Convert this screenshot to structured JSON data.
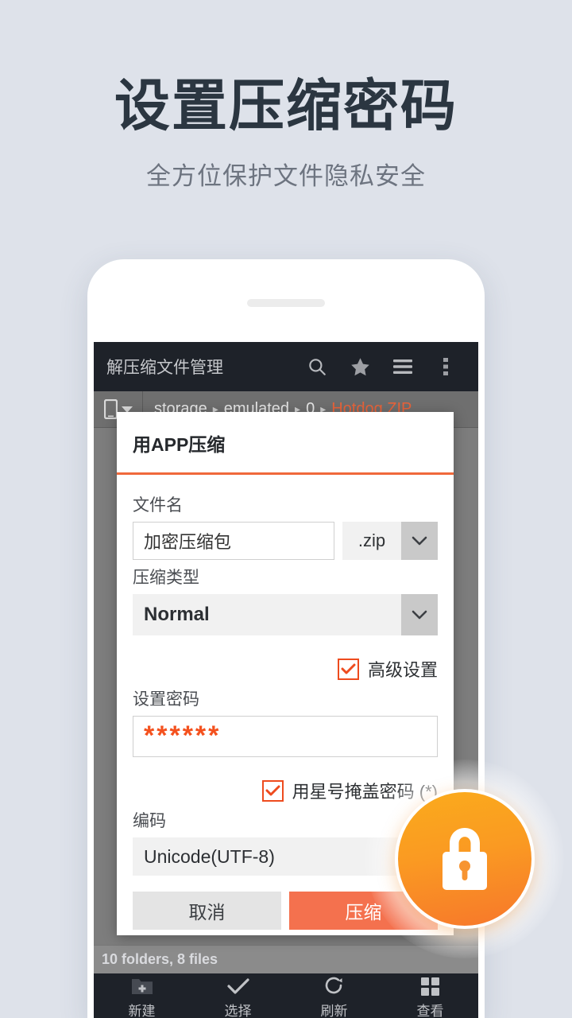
{
  "promo": {
    "title": "设置压缩密码",
    "subtitle": "全方位保护文件隐私安全"
  },
  "colors": {
    "background": "#dee2ea",
    "accent_orange": "#f0693b",
    "button_compress": "#f4714e",
    "checkbox_orange": "#ee4b1e",
    "password_text": "#f4511e",
    "appbar_dark": "#1e2229",
    "breadcrumb_current": "#e8633a"
  },
  "app": {
    "title": "解压缩文件管理",
    "appbar_icons": [
      {
        "name": "search-icon",
        "label": "搜索"
      },
      {
        "name": "star-icon",
        "label": "收藏"
      },
      {
        "name": "hamburger-icon",
        "label": "菜单"
      },
      {
        "name": "overflow-menu-icon",
        "label": "更多"
      }
    ],
    "breadcrumb": {
      "device_icon": "phone-icon",
      "dropdown_icon": "caret-down-icon",
      "separator": "▸",
      "segments": [
        "storage",
        "emulated",
        "0"
      ],
      "current": "Hotdog ZIP"
    },
    "status_text": "10 folders, 8 files",
    "bottom_nav": [
      {
        "icon": "new-folder-icon",
        "label": "新建"
      },
      {
        "icon": "check-icon",
        "label": "选择"
      },
      {
        "icon": "refresh-icon",
        "label": "刷新"
      },
      {
        "icon": "grid-view-icon",
        "label": "查看"
      }
    ]
  },
  "dialog": {
    "title": "用APP压缩",
    "filename": {
      "label": "文件名",
      "value": "加密压缩包",
      "placeholder": "文件名",
      "extension": ".zip"
    },
    "compression_type": {
      "label": "压缩类型",
      "value": "Normal"
    },
    "advanced": {
      "label": "高级设置",
      "checked": true
    },
    "password": {
      "label": "设置密码",
      "value": "******",
      "placeholder": "设置密码"
    },
    "mask_password": {
      "label": "用星号掩盖密码 (*)",
      "checked": true
    },
    "encoding": {
      "label": "编码",
      "value": "Unicode(UTF-8)"
    },
    "buttons": {
      "cancel": "取消",
      "confirm": "压缩"
    }
  },
  "badge": {
    "icon": "lock-icon"
  }
}
